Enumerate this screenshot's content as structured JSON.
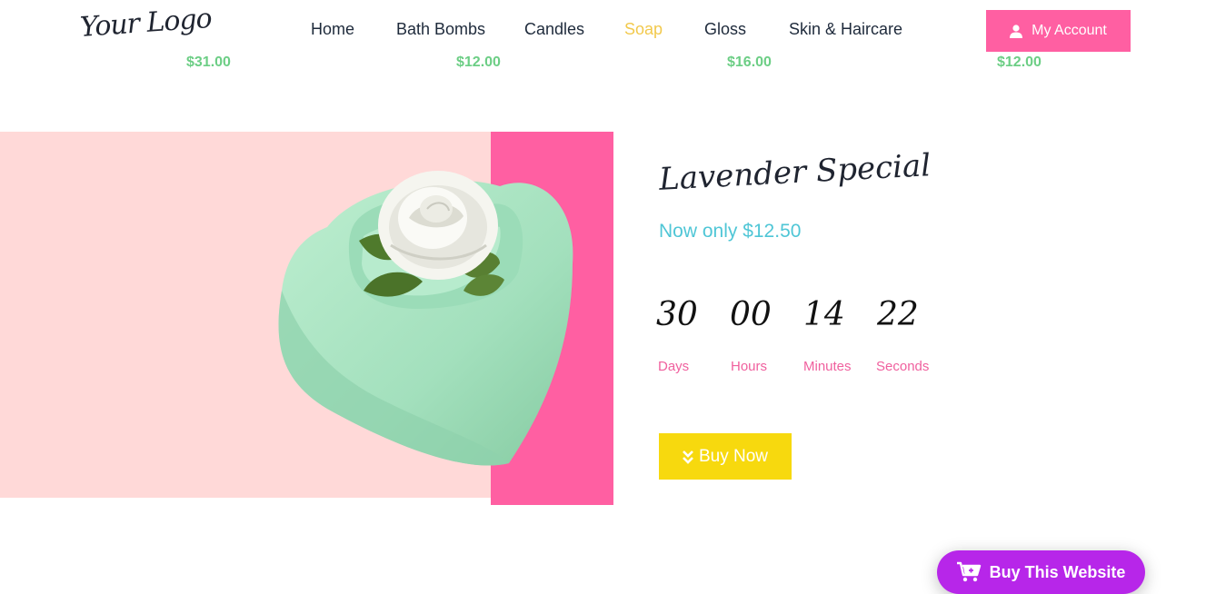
{
  "header": {
    "logo": "Your Logo",
    "nav": [
      "Home",
      "Bath Bombs",
      "Candles",
      "Soap",
      "Gloss",
      "Skin & Haircare"
    ],
    "active_nav": "Soap",
    "account_label": "My Account"
  },
  "product_prices": [
    "$31.00",
    "$12.00",
    "$16.00",
    "$12.00"
  ],
  "promo": {
    "title": "Lavender Special",
    "price": "Now only $12.50",
    "countdown": [
      {
        "value": "30",
        "label": "Days"
      },
      {
        "value": "00",
        "label": "Hours"
      },
      {
        "value": "14",
        "label": "Minutes"
      },
      {
        "value": "22",
        "label": "Seconds"
      }
    ],
    "cta": "Buy Now"
  },
  "floating_cta": "Buy This Website",
  "colors": {
    "accent_pink": "#ff5fa2",
    "light_pink": "#ffd9d8",
    "teal": "#4fc6d6",
    "yellow": "#f7d90e",
    "purple": "#b726e9",
    "price_green": "#6cce85",
    "nav_active": "#f2c94c"
  }
}
